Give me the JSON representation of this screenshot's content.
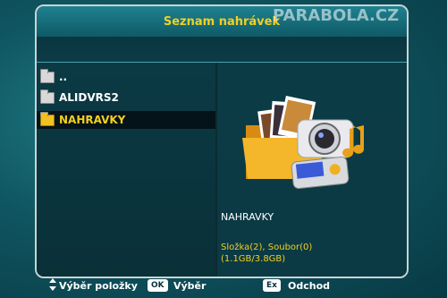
{
  "header": {
    "title": "Seznam nahrávek"
  },
  "watermark": "PARABOLA.CZ",
  "file_list": [
    {
      "label": "..",
      "icon": "folder-icon",
      "selected": false
    },
    {
      "label": "ALIDVRS2",
      "icon": "folder-icon",
      "selected": false
    },
    {
      "label": "NAHRAVKY",
      "icon": "open-folder-icon",
      "selected": true
    }
  ],
  "details": {
    "name": "NAHRAVKY",
    "counts": "Složka(2), Soubor(0)",
    "size": "(1.1GB/3.8GB)",
    "preview_icon": "media-folder-icon"
  },
  "footer": {
    "select_label": "Výběr položky",
    "ok_key": "OK",
    "ok_label": "Výběr",
    "exit_key": "Ex",
    "exit_label": "Odchod"
  }
}
